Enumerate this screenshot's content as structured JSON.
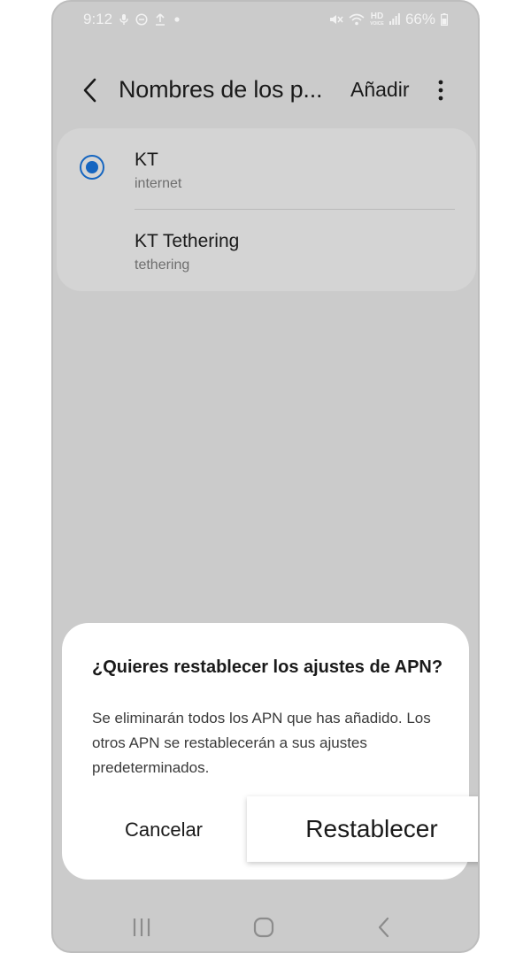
{
  "status_bar": {
    "time": "9:12",
    "battery": "66%",
    "hd_top": "HD",
    "hd_bottom": "VOICE",
    "left_icons": [
      "mic-icon",
      "do-not-disturb-icon",
      "upload-icon",
      "dot-icon"
    ],
    "right_icons": [
      "mute-icon",
      "wifi-icon",
      "hd-voice-icon",
      "signal-icon",
      "battery-icon"
    ]
  },
  "app_bar": {
    "title": "Nombres de los p...",
    "add_label": "Añadir",
    "back_icon": "chevron-left-icon",
    "more_icon": "more-vert-icon"
  },
  "apn_list": {
    "items": [
      {
        "name": "KT",
        "subtitle": "internet",
        "selected": true
      },
      {
        "name": "KT Tethering",
        "subtitle": "tethering",
        "selected": false
      }
    ]
  },
  "dialog": {
    "title": "¿Quieres restablecer los ajustes de APN?",
    "message": "Se eliminarán todos los APN que has añadido. Los otros APN se restablecerán a sus ajustes predeterminados.",
    "cancel_label": "Cancelar",
    "reset_label": "Restablecer"
  },
  "nav_bar": {
    "icons": [
      "recents-icon",
      "home-icon",
      "back-icon"
    ]
  },
  "colors": {
    "screen_bg": "#cbcbcb",
    "card_bg": "#d4d4d4",
    "accent": "#1565c0",
    "dialog_bg": "#ffffff"
  }
}
